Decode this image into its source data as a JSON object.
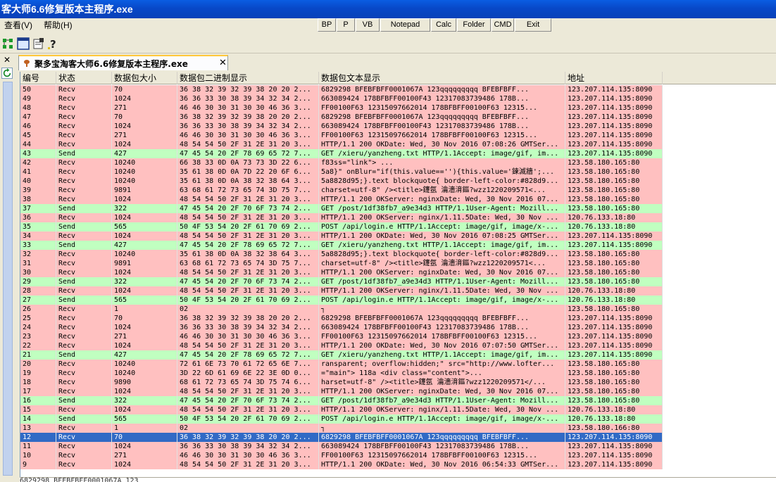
{
  "window": {
    "title": "客大师6.6修复版本主程序.exe"
  },
  "menu": {
    "view": "查看(V)",
    "help": "帮助(H)"
  },
  "toolbar": {
    "bp": "BP",
    "p": "P",
    "vb": "VB",
    "notepad": "Notepad",
    "calc": "Calc",
    "folder": "Folder",
    "cmd": "CMD",
    "exit": "Exit"
  },
  "icons": {
    "toolbar": [
      "tree-icon",
      "window-icon",
      "properties-icon",
      "help-icon"
    ],
    "left": [
      "close-icon",
      "refresh-icon"
    ]
  },
  "tab": {
    "label": "聚多宝淘客大师6.6修复版本主程序.exe"
  },
  "columns": {
    "num": "编号",
    "status": "状态",
    "size": "数据包大小",
    "hex": "数据包二进制显示",
    "text": "数据包文本显示",
    "addr": "地址"
  },
  "colors": {
    "recv": "#ffc0c0",
    "send": "#c0ffc0",
    "selected": "#316ac5"
  },
  "rows": [
    {
      "num": "50",
      "status": "Recv",
      "size": "70",
      "hex": "36 38 32 39 32 39 38 20 20 2...",
      "text": "6829298      BFEBFBFF0001067A   123qqqqqqqqq     BFEBFBFF...",
      "addr": "123.207.114.135:8090"
    },
    {
      "num": "49",
      "status": "Recv",
      "size": "1024",
      "hex": "36 36 33 30 38 39 34 32 34 2...",
      "text": "663089424      178BFBFF00100F43  12317083739486       178B...",
      "addr": "123.207.114.135:8090"
    },
    {
      "num": "48",
      "status": "Recv",
      "size": "271",
      "hex": "46 46 30 30 31 30 30 46 36 3...",
      "text": "FF00100F63  12315097662014       178BFBFF00100F63  12315...",
      "addr": "123.207.114.135:8090"
    },
    {
      "num": "47",
      "status": "Recv",
      "size": "70",
      "hex": "36 38 32 39 32 39 38 20 20 2...",
      "text": "6829298      BFEBFBFF0001067A   123qqqqqqqqq     BFEBFBFF...",
      "addr": "123.207.114.135:8090"
    },
    {
      "num": "46",
      "status": "Recv",
      "size": "1024",
      "hex": "36 36 33 30 38 39 34 32 34 2...",
      "text": "663089424      178BFBFF00100F43  12317083739486       178B...",
      "addr": "123.207.114.135:8090"
    },
    {
      "num": "45",
      "status": "Recv",
      "size": "271",
      "hex": "46 46 30 30 31 30 30 46 36 3...",
      "text": "FF00100F63  12315097662014       178BFBFF00100F63  12315...",
      "addr": "123.207.114.135:8090"
    },
    {
      "num": "44",
      "status": "Recv",
      "size": "1024",
      "hex": "48 54 54 50 2F 31 2E 31 20 3...",
      "text": "HTTP/1.1 200 OKDate: Wed, 30 Nov 2016 07:08:26 GMTSer...",
      "addr": "123.207.114.135:8090"
    },
    {
      "num": "43",
      "status": "Send",
      "size": "427",
      "hex": "47 45 54 20 2F 78 69 65 72 7...",
      "text": "GET /xieru/yanzheng.txt HTTP/1.1Accept: image/gif, im...",
      "addr": "123.207.114.135:8090"
    },
    {
      "num": "42",
      "status": "Recv",
      "size": "10240",
      "hex": "66 38 33 0D 0A 73 73 3D 22 6...",
      "text": "f83ss=\"link\">                                          ...",
      "addr": "123.58.180.165:80"
    },
    {
      "num": "41",
      "status": "Recv",
      "size": "10240",
      "hex": "35 61 38 0D 0A 7D 22 20 6F 6...",
      "text": "5a8}\" onBlur=\"if(this.value==''){this.value='鍊滅牆';...",
      "addr": "123.58.180.165:80"
    },
    {
      "num": "40",
      "status": "Recv",
      "size": "10240",
      "hex": "35 61 38 0D 0A 38 32 38 64 3...",
      "text": "5a8828d95;}.text blockquote{ border-left-color:#828d9...",
      "addr": "123.58.180.165:80"
    },
    {
      "num": "39",
      "status": "Recv",
      "size": "9891",
      "hex": "63 68 61 72 73 65 74 3D 75 7...",
      "text": "charset=utf-8\" /><title>鑳氬  瀹濇湇鏂?wzz1220209571<...",
      "addr": "123.58.180.165:80"
    },
    {
      "num": "38",
      "status": "Recv",
      "size": "1024",
      "hex": "48 54 54 50 2F 31 2E 31 20 3...",
      "text": "HTTP/1.1 200 OKServer: nginxDate: Wed, 30 Nov 2016 07...",
      "addr": "123.58.180.165:80"
    },
    {
      "num": "37",
      "status": "Send",
      "size": "322",
      "hex": "47 45 54 20 2F 70 6F 73 74 2...",
      "text": "GET /post/1df38fb7_a9e34d3 HTTP/1.1User-Agent: Mozill...",
      "addr": "123.58.180.165:80"
    },
    {
      "num": "36",
      "status": "Recv",
      "size": "1024",
      "hex": "48 54 54 50 2F 31 2E 31 20 3...",
      "text": "HTTP/1.1 200 OKServer: nginx/1.11.5Date: Wed, 30 Nov ...",
      "addr": "120.76.133.18:80"
    },
    {
      "num": "35",
      "status": "Send",
      "size": "565",
      "hex": "50 4F 53 54 20 2F 61 70 69 2...",
      "text": "POST /api/login.e HTTP/1.1Accept: image/gif, image/x-...",
      "addr": "120.76.133.18:80"
    },
    {
      "num": "34",
      "status": "Recv",
      "size": "1024",
      "hex": "48 54 54 50 2F 31 2E 31 20 3...",
      "text": "HTTP/1.1 200 OKDate: Wed, 30 Nov 2016 07:08:25 GMTSer...",
      "addr": "123.207.114.135:8090"
    },
    {
      "num": "33",
      "status": "Send",
      "size": "427",
      "hex": "47 45 54 20 2F 78 69 65 72 7...",
      "text": "GET /xieru/yanzheng.txt HTTP/1.1Accept: image/gif, im...",
      "addr": "123.207.114.135:8090"
    },
    {
      "num": "32",
      "status": "Recv",
      "size": "10240",
      "hex": "35 61 38 0D 0A 38 32 38 64 3...",
      "text": "5a8828d95;}.text blockquote{ border-left-color:#828d9...",
      "addr": "123.58.180.165:80"
    },
    {
      "num": "31",
      "status": "Recv",
      "size": "9891",
      "hex": "63 68 61 72 73 65 74 3D 75 7...",
      "text": "charset=utf-8\" /><title>鑳氬  瀹濇湇鏂?wzz1220209571<...",
      "addr": "123.58.180.165:80"
    },
    {
      "num": "30",
      "status": "Recv",
      "size": "1024",
      "hex": "48 54 54 50 2F 31 2E 31 20 3...",
      "text": "HTTP/1.1 200 OKServer: nginxDate: Wed, 30 Nov 2016 07...",
      "addr": "123.58.180.165:80"
    },
    {
      "num": "29",
      "status": "Send",
      "size": "322",
      "hex": "47 45 54 20 2F 70 6F 73 74 2...",
      "text": "GET /post/1df38fb7_a9e34d3 HTTP/1.1User-Agent: Mozill...",
      "addr": "123.58.180.165:80"
    },
    {
      "num": "28",
      "status": "Recv",
      "size": "1024",
      "hex": "48 54 54 50 2F 31 2E 31 20 3...",
      "text": "HTTP/1.1 200 OKServer: nginx/1.11.5Date: Wed, 30 Nov ...",
      "addr": "120.76.133.18:80"
    },
    {
      "num": "27",
      "status": "Send",
      "size": "565",
      "hex": "50 4F 53 54 20 2F 61 70 69 2...",
      "text": "POST /api/login.e HTTP/1.1Accept: image/gif, image/x-...",
      "addr": "120.76.133.18:80"
    },
    {
      "num": "26",
      "status": "Recv",
      "size": "1",
      "hex": "02",
      "text": "┐",
      "addr": "123.58.180.165:80"
    },
    {
      "num": "25",
      "status": "Recv",
      "size": "70",
      "hex": "36 38 32 39 32 39 38 20 20 2...",
      "text": "6829298      BFEBFBFF0001067A   123qqqqqqqqq     BFEBFBFF...",
      "addr": "123.207.114.135:8090"
    },
    {
      "num": "24",
      "status": "Recv",
      "size": "1024",
      "hex": "36 36 33 30 38 39 34 32 34 2...",
      "text": "663089424      178BFBFF00100F43  12317083739486       178B...",
      "addr": "123.207.114.135:8090"
    },
    {
      "num": "23",
      "status": "Recv",
      "size": "271",
      "hex": "46 46 30 30 31 30 30 46 36 3...",
      "text": "FF00100F63  12315097662014       178BFBFF00100F63  12315...",
      "addr": "123.207.114.135:8090"
    },
    {
      "num": "22",
      "status": "Recv",
      "size": "1024",
      "hex": "48 54 54 50 2F 31 2E 31 20 3...",
      "text": "HTTP/1.1 200 OKDate: Wed, 30 Nov 2016 07:07:50 GMTSer...",
      "addr": "123.207.114.135:8090"
    },
    {
      "num": "21",
      "status": "Send",
      "size": "427",
      "hex": "47 45 54 20 2F 78 69 65 72 7...",
      "text": "GET /xieru/yanzheng.txt HTTP/1.1Accept: image/gif, im...",
      "addr": "123.207.114.135:8090"
    },
    {
      "num": "20",
      "status": "Recv",
      "size": "10240",
      "hex": "72 61 6E 73 70 61 72 65 6E 7...",
      "text": "ransparent; overflow:hidden;\" src=\"http://www.lofter...",
      "addr": "123.58.180.165:80"
    },
    {
      "num": "19",
      "status": "Recv",
      "size": "10240",
      "hex": "3D 22 6D 61 69 6E 22 3E 0D 0...",
      "text": "=\"main\">             118a  <div class=\"content\">...",
      "addr": "123.58.180.165:80"
    },
    {
      "num": "18",
      "status": "Recv",
      "size": "9890",
      "hex": "68 61 72 73 65 74 3D 75 74 6...",
      "text": "harset=utf-8\" /><title>鑳氬  瀹濇湇鏂?wzz1220209571</...",
      "addr": "123.58.180.165:80"
    },
    {
      "num": "17",
      "status": "Recv",
      "size": "1024",
      "hex": "48 54 54 50 2F 31 2E 31 20 3...",
      "text": "HTTP/1.1 200 OKServer: nginxDate: Wed, 30 Nov 2016 07...",
      "addr": "123.58.180.165:80"
    },
    {
      "num": "16",
      "status": "Send",
      "size": "322",
      "hex": "47 45 54 20 2F 70 6F 73 74 2...",
      "text": "GET /post/1df38fb7_a9e34d3 HTTP/1.1User-Agent: Mozill...",
      "addr": "123.58.180.165:80"
    },
    {
      "num": "15",
      "status": "Recv",
      "size": "1024",
      "hex": "48 54 54 50 2F 31 2E 31 20 3...",
      "text": "HTTP/1.1 200 OKServer: nginx/1.11.5Date: Wed, 30 Nov ...",
      "addr": "120.76.133.18:80"
    },
    {
      "num": "14",
      "status": "Send",
      "size": "565",
      "hex": "50 4F 53 54 20 2F 61 70 69 2...",
      "text": "POST /api/login.e HTTP/1.1Accept: image/gif, image/x-...",
      "addr": "120.76.133.18:80"
    },
    {
      "num": "13",
      "status": "Recv",
      "size": "1",
      "hex": "02",
      "text": "┐",
      "addr": "123.58.180.166:80"
    },
    {
      "num": "12",
      "status": "Recv",
      "size": "70",
      "hex": "36 38 32 39 32 39 38 20 20 2...",
      "text": "6829298      BFEBFBFF0001067A   123qqqqqqqqq     BFEBFBFF...",
      "addr": "123.207.114.135:8090",
      "selected": true
    },
    {
      "num": "11",
      "status": "Recv",
      "size": "1024",
      "hex": "36 36 33 30 38 39 34 32 34 2...",
      "text": "663089424      178BFBFF00100F43  12317083739486       178B...",
      "addr": "123.207.114.135:8090"
    },
    {
      "num": "10",
      "status": "Recv",
      "size": "271",
      "hex": "46 46 30 30 31 30 30 46 36 3...",
      "text": "FF00100F63  12315097662014       178BFBFF00100F63  12315...",
      "addr": "123.207.114.135:8090"
    },
    {
      "num": "9",
      "status": "Recv",
      "size": "1024",
      "hex": "48 54 54 50 2F 31 2E 31 20 3...",
      "text": "HTTP/1.1 200 OKDate: Wed, 30 Nov 2016 06:54:33 GMTSer...",
      "addr": "123.207.114.135:8090"
    }
  ],
  "status": {
    "text": "6829298     BFEBFBFF0001067A   123"
  }
}
